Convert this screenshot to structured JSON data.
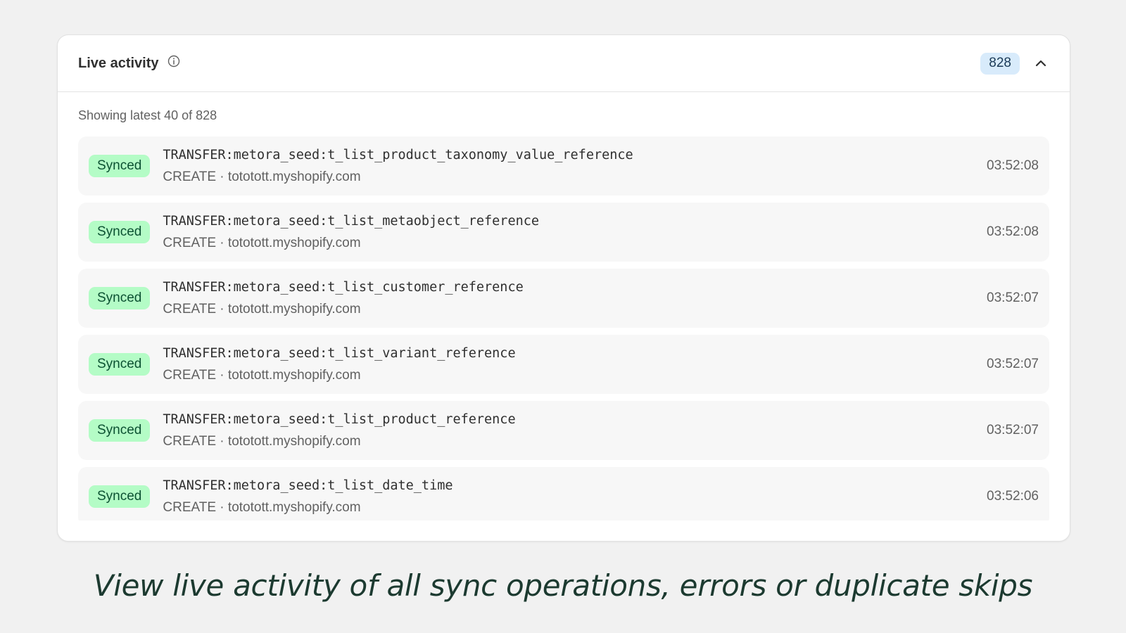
{
  "header": {
    "title": "Live activity",
    "count": "828"
  },
  "summary": "Showing latest 40 of 828",
  "colors": {
    "synced_bg": "#b4fcc6",
    "synced_text": "#0c5132",
    "count_bg": "#d8ebfb"
  },
  "icons": {
    "info": "info-icon",
    "collapse": "chevron-up-icon"
  },
  "rows": [
    {
      "status": "Synced",
      "title": "TRANSFER:metora_seed:t_list_product_taxonomy_value_reference",
      "subtitle": "CREATE · tototott.myshopify.com",
      "time": "03:52:08"
    },
    {
      "status": "Synced",
      "title": "TRANSFER:metora_seed:t_list_metaobject_reference",
      "subtitle": "CREATE · tototott.myshopify.com",
      "time": "03:52:08"
    },
    {
      "status": "Synced",
      "title": "TRANSFER:metora_seed:t_list_customer_reference",
      "subtitle": "CREATE · tototott.myshopify.com",
      "time": "03:52:07"
    },
    {
      "status": "Synced",
      "title": "TRANSFER:metora_seed:t_list_variant_reference",
      "subtitle": "CREATE · tototott.myshopify.com",
      "time": "03:52:07"
    },
    {
      "status": "Synced",
      "title": "TRANSFER:metora_seed:t_list_product_reference",
      "subtitle": "CREATE · tototott.myshopify.com",
      "time": "03:52:07"
    },
    {
      "status": "Synced",
      "title": "TRANSFER:metora_seed:t_list_date_time",
      "subtitle": "CREATE · tototott.myshopify.com",
      "time": "03:52:06"
    }
  ],
  "caption": "View live activity of all sync operations, errors or duplicate skips"
}
